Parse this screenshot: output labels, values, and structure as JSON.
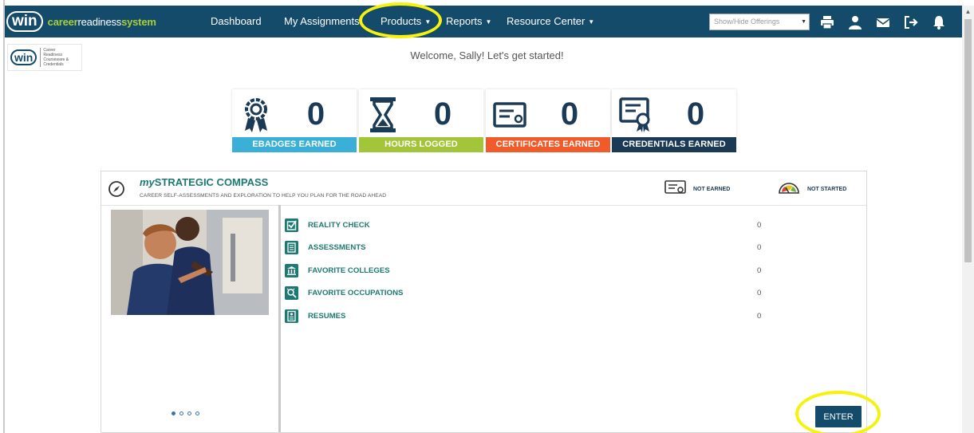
{
  "brand": {
    "logo": "win",
    "part1": "career",
    "part2": "readiness",
    "part3": "system"
  },
  "nav": {
    "items": [
      {
        "label": "Dashboard",
        "caret": false
      },
      {
        "label": "My Assignments",
        "caret": false
      },
      {
        "label": "Products",
        "caret": true
      },
      {
        "label": "Reports",
        "caret": true
      },
      {
        "label": "Resource Center",
        "caret": true
      }
    ],
    "offerings_placeholder": "Show/Hide Offerings",
    "icons": [
      "print-icon",
      "user-icon",
      "mail-icon",
      "logout-icon",
      "bell-icon"
    ]
  },
  "small_logo": {
    "mark": "win",
    "text": "Career Readiness Courseware & Credentials"
  },
  "welcome": "Welcome, Sally! Let's get started!",
  "stats": [
    {
      "value": "0",
      "label": "EBADGES EARNED",
      "color": "#3ab0d8",
      "icon": "ribbon-icon"
    },
    {
      "value": "0",
      "label": "HOURS LOGGED",
      "color": "#a2c53a",
      "icon": "hourglass-icon"
    },
    {
      "value": "0",
      "label": "CERTIFICATES EARNED",
      "color": "#f15a29",
      "icon": "certificate-icon"
    },
    {
      "value": "0",
      "label": "CREDENTIALS EARNED",
      "color": "#1b3a56",
      "icon": "credential-icon"
    }
  ],
  "panel": {
    "title_prefix": "my",
    "title_main": "STRATEGIC COMPASS",
    "subtitle": "CAREER SELF-ASSESSMENTS AND EXPLORATION TO HELP YOU PLAN FOR THE ROAD AHEAD",
    "status_earned": "NOT EARNED",
    "status_started": "NOT STARTED",
    "items": [
      {
        "label": "REALITY CHECK",
        "value": "0",
        "icon": "checkbox-icon"
      },
      {
        "label": "ASSESSMENTS",
        "value": "0",
        "icon": "document-icon"
      },
      {
        "label": "FAVORITE COLLEGES",
        "value": "0",
        "icon": "college-icon"
      },
      {
        "label": "FAVORITE OCCUPATIONS",
        "value": "0",
        "icon": "occupation-search-icon"
      },
      {
        "label": "RESUMES",
        "value": "0",
        "icon": "resume-icon"
      }
    ],
    "carousel_active": 1,
    "carousel_count": 4,
    "enter_label": "ENTER"
  },
  "colors": {
    "nav_bg": "#144a6a",
    "accent_teal": "#1d7a72",
    "highlight": "#f6f20c",
    "brand_green": "#a7cf38"
  }
}
